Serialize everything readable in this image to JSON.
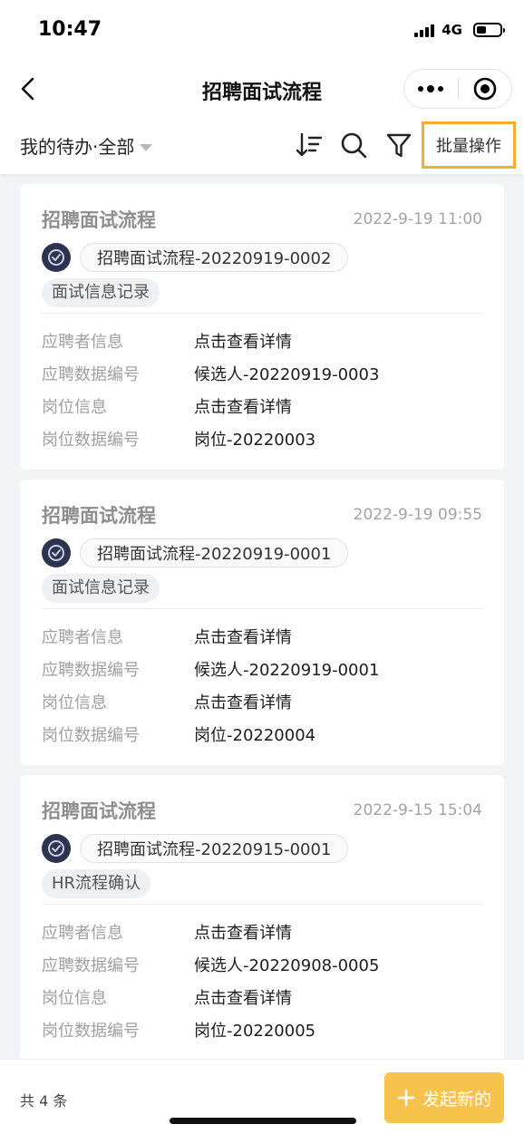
{
  "status_bar": {
    "time": "10:47",
    "network": "4G",
    "battery_level": 0.4
  },
  "nav": {
    "title": "招聘面试流程",
    "back_icon": "chevron-left-icon",
    "more_icon": "more-dots-icon",
    "close_icon": "target-circle-icon"
  },
  "filter": {
    "label": "我的待办·全部",
    "sort_icon": "sort-icon",
    "search_icon": "search-icon",
    "filter_icon": "funnel-icon",
    "batch_label": "批量操作",
    "highlight_color": "#f5ad2e"
  },
  "cards": [
    {
      "title": "招聘面试流程",
      "time": "2022-9-19 11:00",
      "process_id": "招聘面试流程-20220919-0002",
      "stage": "面试信息记录",
      "fields": [
        {
          "label": "应聘者信息",
          "value": "点击查看详情"
        },
        {
          "label": "应聘数据编号",
          "value": "候选人-20220919-0003"
        },
        {
          "label": "岗位信息",
          "value": "点击查看详情"
        },
        {
          "label": "岗位数据编号",
          "value": "岗位-20220003"
        }
      ]
    },
    {
      "title": "招聘面试流程",
      "time": "2022-9-19 09:55",
      "process_id": "招聘面试流程-20220919-0001",
      "stage": "面试信息记录",
      "fields": [
        {
          "label": "应聘者信息",
          "value": "点击查看详情"
        },
        {
          "label": "应聘数据编号",
          "value": "候选人-20220919-0001"
        },
        {
          "label": "岗位信息",
          "value": "点击查看详情"
        },
        {
          "label": "岗位数据编号",
          "value": "岗位-20220004"
        }
      ]
    },
    {
      "title": "招聘面试流程",
      "time": "2022-9-15 15:04",
      "process_id": "招聘面试流程-20220915-0001",
      "stage": "HR流程确认",
      "fields": [
        {
          "label": "应聘者信息",
          "value": "点击查看详情"
        },
        {
          "label": "应聘数据编号",
          "value": "候选人-20220908-0005"
        },
        {
          "label": "岗位信息",
          "value": "点击查看详情"
        },
        {
          "label": "岗位数据编号",
          "value": "岗位-20220005"
        }
      ]
    }
  ],
  "bottom": {
    "total": "共 4 条",
    "new_label": "发起新的",
    "new_icon": "plus-icon",
    "accent_color": "#f8c34d"
  }
}
